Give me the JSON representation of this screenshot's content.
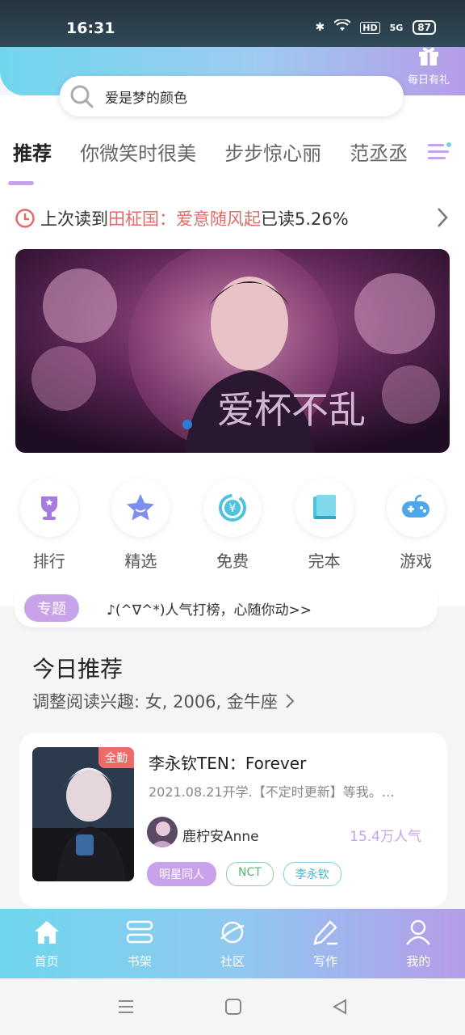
{
  "status": {
    "time": "16:31",
    "network": "5G",
    "battery": "87"
  },
  "header": {
    "gift_label": "每日有礼"
  },
  "search": {
    "query": "爱是梦的颜色"
  },
  "tabs": [
    {
      "label": "推荐",
      "active": true
    },
    {
      "label": "你微笑时很美"
    },
    {
      "label": "步步惊心丽"
    },
    {
      "label": "范丞丞"
    }
  ],
  "last_read": {
    "prefix": "上次读到",
    "book": "田柾国：爱意随风起",
    "progress_label": "已读5.26%"
  },
  "banner": {
    "text": "爱杯不乱"
  },
  "categories": [
    {
      "label": "排行",
      "icon": "trophy-icon"
    },
    {
      "label": "精选",
      "icon": "star-icon"
    },
    {
      "label": "免费",
      "icon": "yen-icon"
    },
    {
      "label": "完本",
      "icon": "book-icon"
    },
    {
      "label": "游戏",
      "icon": "gamepad-icon"
    }
  ],
  "topic": {
    "badge": "专题",
    "text": "♪(^∇^*)人气打榜，心随你动>>"
  },
  "today": {
    "title": "今日推荐",
    "subtitle": "调整阅读兴趣: 女, 2006, 金牛座"
  },
  "book_card": {
    "badge": "全勤",
    "title": "李永钦TEN：Forever",
    "desc": "2021.08.21开学.【不定时更新】等我。…",
    "author": "鹿柠安Anne",
    "popularity": "15.4万人气",
    "tags": [
      "明星同人",
      "NCT",
      "李永钦"
    ]
  },
  "bottom_nav": [
    {
      "label": "首页",
      "icon": "home-icon",
      "active": true
    },
    {
      "label": "书架",
      "icon": "bookshelf-icon"
    },
    {
      "label": "社区",
      "icon": "planet-icon"
    },
    {
      "label": "写作",
      "icon": "pen-icon"
    },
    {
      "label": "我的",
      "icon": "user-icon"
    }
  ],
  "colors": {
    "accent": "#c9a3ea",
    "brand_cyan": "#6fd6ee",
    "highlight": "#e26a6a"
  }
}
